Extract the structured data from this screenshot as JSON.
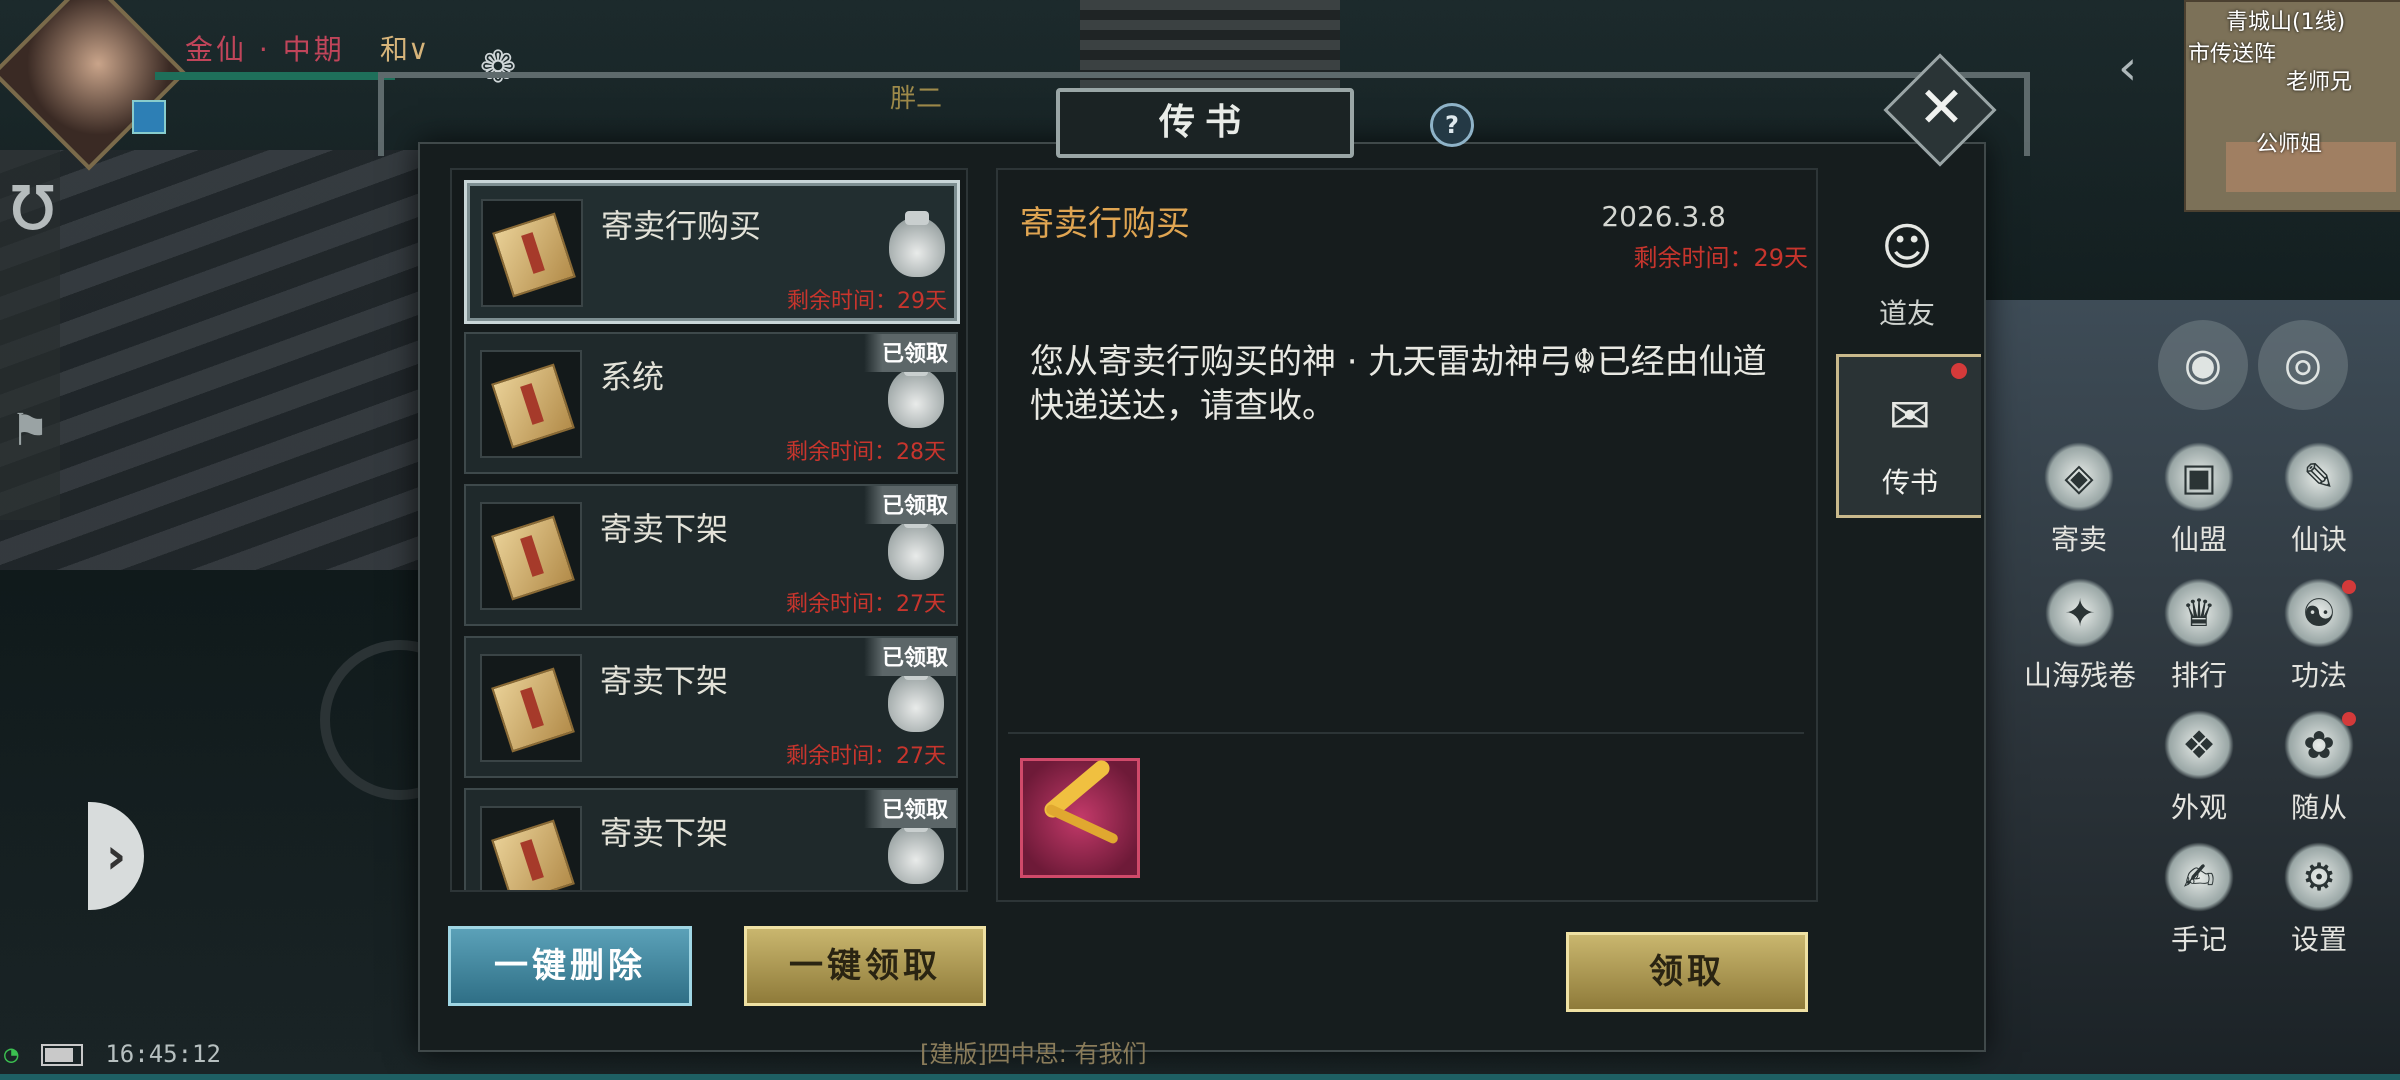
{
  "hud": {
    "realm": "金仙 · 中期",
    "realm_suffix": "和∨",
    "npc_label": "胖二",
    "clock": "16:45:12",
    "bottom_chat": "[建版]四中思: 有我们"
  },
  "minimap": {
    "region": "青城山(1线)",
    "labels": [
      "市传送阵",
      "老师兄",
      "公师姐"
    ]
  },
  "dialog": {
    "title": "传书",
    "help": "?",
    "close": "✕"
  },
  "mail_list": [
    {
      "name": "寄卖行购买",
      "remain": "剩余时间：29天",
      "claimed": "",
      "selected": true
    },
    {
      "name": "系统",
      "remain": "剩余时间：28天",
      "claimed": "已领取"
    },
    {
      "name": "寄卖下架",
      "remain": "剩余时间：27天",
      "claimed": "已领取"
    },
    {
      "name": "寄卖下架",
      "remain": "剩余时间：27天",
      "claimed": "已领取"
    },
    {
      "name": "寄卖下架",
      "remain": "",
      "claimed": "已领取"
    }
  ],
  "detail": {
    "title": "寄卖行购买",
    "date": "2026.3.8",
    "remain": "剩余时间：29天",
    "body": "您从寄卖行购买的神 · 九天雷劫神弓☬已经由仙道快递送达，请查收。",
    "attachment_icon": "golden-bow-icon"
  },
  "tabs": [
    {
      "label": "道友",
      "icon": "friend-icon"
    },
    {
      "label": "传书",
      "icon": "mail-chat-icon",
      "active": true
    }
  ],
  "buttons": {
    "delete_all": "一键删除",
    "claim_all": "一键领取",
    "claim": "领取"
  },
  "right_menu": [
    {
      "label": "寄卖"
    },
    {
      "label": "仙盟"
    },
    {
      "label": "仙诀"
    },
    {
      "label": "山海残卷"
    },
    {
      "label": "排行"
    },
    {
      "label": "功法"
    },
    {
      "label": "外观"
    },
    {
      "label": "随从"
    },
    {
      "label": "手记"
    },
    {
      "label": "设置"
    }
  ],
  "colors": {
    "mail_title": "#e0a552",
    "remain_red": "#c8352d",
    "gold_button": "#c9b66e",
    "blue_button": "#5ba1b8"
  }
}
